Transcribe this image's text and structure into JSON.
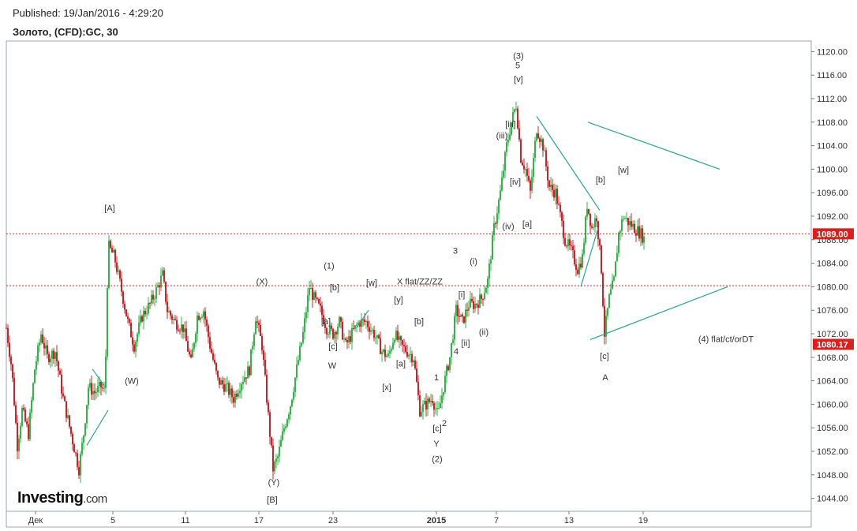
{
  "header": {
    "published": "Published: 19/Jan/2016 - 4:29:20",
    "symbol": "Золото, (CFD):GC, 30"
  },
  "logo": {
    "main": "Investing",
    "domain": ".com"
  },
  "chart_data": {
    "type": "candlestick",
    "ylim": [
      1041,
      1122
    ],
    "y_ticks": [
      1044,
      1048,
      1052,
      1056,
      1060,
      1064,
      1068,
      1072,
      1076,
      1080,
      1084,
      1088,
      1092,
      1096,
      1100,
      1104,
      1108,
      1112,
      1116,
      1120
    ],
    "x_index_range": [
      0,
      1020
    ],
    "x_ticks": [
      {
        "x": 45,
        "label": "Дек"
      },
      {
        "x": 143,
        "label": "5"
      },
      {
        "x": 235,
        "label": "11"
      },
      {
        "x": 328,
        "label": "17"
      },
      {
        "x": 422,
        "label": "23"
      },
      {
        "x": 553,
        "label": "2015",
        "bold": true
      },
      {
        "x": 629,
        "label": "7"
      },
      {
        "x": 721,
        "label": "13"
      },
      {
        "x": 815,
        "label": "19"
      }
    ],
    "anchors": [
      [
        8,
        1073
      ],
      [
        15,
        1066
      ],
      [
        22,
        1053
      ],
      [
        28,
        1059
      ],
      [
        36,
        1055
      ],
      [
        44,
        1066
      ],
      [
        52,
        1072
      ],
      [
        60,
        1068
      ],
      [
        70,
        1069
      ],
      [
        80,
        1061
      ],
      [
        90,
        1055
      ],
      [
        100,
        1049
      ],
      [
        106,
        1055
      ],
      [
        112,
        1063
      ],
      [
        120,
        1062
      ],
      [
        128,
        1063
      ],
      [
        133,
        1062
      ],
      [
        137,
        1087
      ],
      [
        145,
        1085
      ],
      [
        153,
        1080
      ],
      [
        162,
        1074
      ],
      [
        170,
        1070
      ],
      [
        180,
        1075
      ],
      [
        190,
        1077
      ],
      [
        200,
        1080
      ],
      [
        206,
        1082
      ],
      [
        212,
        1076
      ],
      [
        222,
        1074
      ],
      [
        232,
        1073
      ],
      [
        242,
        1067
      ],
      [
        250,
        1075
      ],
      [
        258,
        1076
      ],
      [
        266,
        1070
      ],
      [
        276,
        1064
      ],
      [
        286,
        1063
      ],
      [
        296,
        1061
      ],
      [
        306,
        1064
      ],
      [
        316,
        1066
      ],
      [
        324,
        1075
      ],
      [
        332,
        1070
      ],
      [
        340,
        1058
      ],
      [
        346,
        1049
      ],
      [
        352,
        1051
      ],
      [
        360,
        1056
      ],
      [
        368,
        1060
      ],
      [
        376,
        1066
      ],
      [
        384,
        1072
      ],
      [
        392,
        1080
      ],
      [
        398,
        1078
      ],
      [
        406,
        1076
      ],
      [
        414,
        1073
      ],
      [
        422,
        1072
      ],
      [
        430,
        1074
      ],
      [
        438,
        1070
      ],
      [
        446,
        1072
      ],
      [
        455,
        1074
      ],
      [
        464,
        1074
      ],
      [
        474,
        1072
      ],
      [
        484,
        1069
      ],
      [
        492,
        1068
      ],
      [
        500,
        1072
      ],
      [
        508,
        1070
      ],
      [
        516,
        1069
      ],
      [
        524,
        1068
      ],
      [
        532,
        1059
      ],
      [
        540,
        1060
      ],
      [
        548,
        1061
      ],
      [
        555,
        1058
      ],
      [
        562,
        1063
      ],
      [
        570,
        1068
      ],
      [
        578,
        1076
      ],
      [
        586,
        1074
      ],
      [
        594,
        1077
      ],
      [
        602,
        1077
      ],
      [
        610,
        1078
      ],
      [
        618,
        1081
      ],
      [
        626,
        1090
      ],
      [
        634,
        1096
      ],
      [
        642,
        1104
      ],
      [
        648,
        1108
      ],
      [
        654,
        1111
      ],
      [
        660,
        1102
      ],
      [
        666,
        1100
      ],
      [
        672,
        1096
      ],
      [
        680,
        1107
      ],
      [
        688,
        1104
      ],
      [
        696,
        1097
      ],
      [
        704,
        1096
      ],
      [
        710,
        1092
      ],
      [
        716,
        1088
      ],
      [
        724,
        1086
      ],
      [
        732,
        1083
      ],
      [
        738,
        1085
      ],
      [
        744,
        1094
      ],
      [
        750,
        1090
      ],
      [
        756,
        1092
      ],
      [
        762,
        1083
      ],
      [
        766,
        1072
      ],
      [
        772,
        1078
      ],
      [
        778,
        1081
      ],
      [
        784,
        1089
      ],
      [
        790,
        1092
      ],
      [
        796,
        1091
      ],
      [
        804,
        1090
      ],
      [
        812,
        1089
      ],
      [
        817,
        1088
      ]
    ],
    "price_lines": [
      {
        "value": 1089.0,
        "label": "1089.00"
      },
      {
        "value": 1080.17,
        "label": "1080.17"
      }
    ],
    "last_price_label": {
      "value": 1070.2,
      "label": "1080.17"
    },
    "trendlines": [
      [
        [
          110,
          1053
        ],
        [
          137,
          1059
        ]
      ],
      [
        [
          117,
          1066
        ],
        [
          133,
          1063
        ]
      ],
      [
        [
          452,
          1073
        ],
        [
          467,
          1076
        ]
      ],
      [
        [
          680,
          1109
        ],
        [
          760,
          1093
        ]
      ],
      [
        [
          736,
          1080
        ],
        [
          758,
          1090
        ]
      ],
      [
        [
          745,
          1108
        ],
        [
          912,
          1100
        ]
      ],
      [
        [
          748,
          1071
        ],
        [
          922,
          1080
        ]
      ]
    ],
    "annotations": [
      {
        "text": "(3)",
        "x": 657,
        "y": 1118.8
      },
      {
        "text": "5",
        "x": 656,
        "y": 1117.2
      },
      {
        "text": "[v]",
        "x": 657,
        "y": 1114.8
      },
      {
        "text": "[iii]",
        "x": 647,
        "y": 1107.2
      },
      {
        "text": "(iii)",
        "x": 636,
        "y": 1105.2
      },
      {
        "text": "[iv]",
        "x": 653,
        "y": 1097.4
      },
      {
        "text": "[a]",
        "x": 668,
        "y": 1090.2
      },
      {
        "text": "(iv)",
        "x": 644,
        "y": 1089.8
      },
      {
        "text": "[b]",
        "x": 761,
        "y": 1097.7
      },
      {
        "text": "[w]",
        "x": 790,
        "y": 1099.4
      },
      {
        "text": "[c]",
        "x": 766,
        "y": 1067.7
      },
      {
        "text": "A",
        "x": 767,
        "y": 1064.1
      },
      {
        "text": "(4) flat/ct/orDT",
        "x": 920,
        "y": 1070.6
      },
      {
        "text": "3",
        "x": 577,
        "y": 1085.6
      },
      {
        "text": "(i)",
        "x": 600,
        "y": 1083.8
      },
      {
        "text": "[i]",
        "x": 585,
        "y": 1078.2
      },
      {
        "text": "(ii)",
        "x": 613,
        "y": 1071.8
      },
      {
        "text": "[ii]",
        "x": 590,
        "y": 1069.9
      },
      {
        "text": "4",
        "x": 578,
        "y": 1068.5
      },
      {
        "text": "1",
        "x": 553,
        "y": 1064.1
      },
      {
        "text": "[c]",
        "x": 554,
        "y": 1055.4
      },
      {
        "text": "2",
        "x": 563,
        "y": 1056.3
      },
      {
        "text": "Y",
        "x": 553,
        "y": 1052.8
      },
      {
        "text": "(2)",
        "x": 554,
        "y": 1050.2
      },
      {
        "text": "X flat/ZZ/ZZ",
        "x": 532,
        "y": 1080.4
      },
      {
        "text": "[w]",
        "x": 471,
        "y": 1080.2
      },
      {
        "text": "[y]",
        "x": 505,
        "y": 1077.3
      },
      {
        "text": "[b]",
        "x": 531,
        "y": 1073.6
      },
      {
        "text": "[a]",
        "x": 508,
        "y": 1066.4
      },
      {
        "text": "[x]",
        "x": 490,
        "y": 1062.4
      },
      {
        "text": "(1)",
        "x": 417,
        "y": 1083.1
      },
      {
        "text": "[b]",
        "x": 424,
        "y": 1079.4
      },
      {
        "text": "[a]",
        "x": 413,
        "y": 1073.6
      },
      {
        "text": "[c]",
        "x": 422,
        "y": 1069.4
      },
      {
        "text": "W",
        "x": 421,
        "y": 1066.1
      },
      {
        "text": "(X)",
        "x": 332,
        "y": 1080.4
      },
      {
        "text": "(Y)",
        "x": 347,
        "y": 1046.2
      },
      {
        "text": "[B]",
        "x": 345,
        "y": 1043.3
      },
      {
        "text": "[A]",
        "x": 139,
        "y": 1092.9
      },
      {
        "text": "(W)",
        "x": 167,
        "y": 1063.5
      }
    ]
  }
}
